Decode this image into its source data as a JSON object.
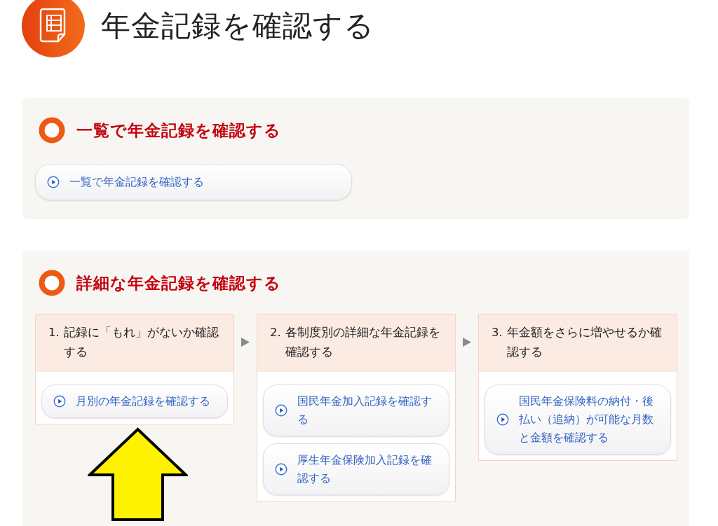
{
  "page_title": "年金記録を確認する",
  "sections": [
    {
      "heading": "一覧で年金記録を確認する",
      "links": [
        "一覧で年金記録を確認する"
      ]
    },
    {
      "heading": "詳細な年金記録を確認する",
      "steps": [
        {
          "number": "1.",
          "title": "記録に「もれ」がないか確認する",
          "links": [
            "月別の年金記録を確認する"
          ]
        },
        {
          "number": "2.",
          "title": "各制度別の詳細な年金記録を確認する",
          "links": [
            "国民年金加入記録を確認する",
            "厚生年金保険加入記録を確認する"
          ]
        },
        {
          "number": "3.",
          "title": "年金額をさらに増やせるか確認する",
          "links": [
            "国民年金保険料の納付・後払い（追納）が可能な月数と金額を確認する"
          ]
        }
      ]
    }
  ]
}
